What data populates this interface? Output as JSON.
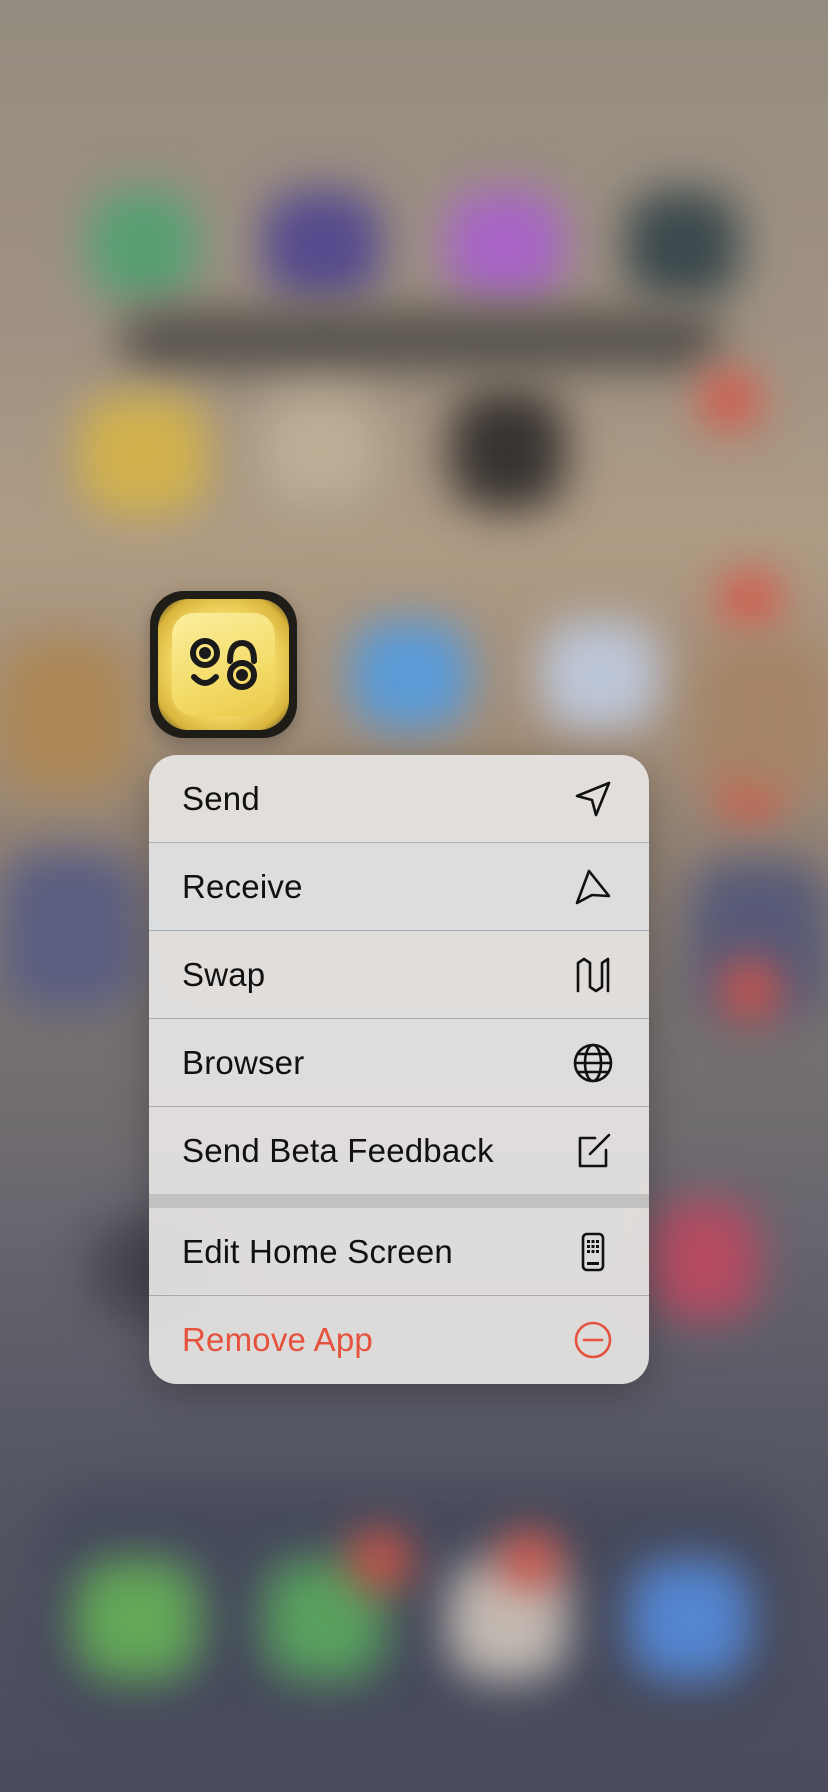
{
  "app": {
    "icon_name": "wallet-app-icon",
    "icon_colors": {
      "face": "#f4dc6a",
      "frame": "#1f1d18",
      "glyph": "#1a1a1a"
    }
  },
  "menu": {
    "actions": [
      {
        "label": "Send",
        "icon": "send-arrow-icon"
      },
      {
        "label": "Receive",
        "icon": "receive-arrow-icon"
      },
      {
        "label": "Swap",
        "icon": "swap-icon"
      },
      {
        "label": "Browser",
        "icon": "globe-icon"
      },
      {
        "label": "Send Beta Feedback",
        "icon": "compose-icon"
      }
    ],
    "system": [
      {
        "label": "Edit Home Screen",
        "icon": "phone-grid-icon"
      },
      {
        "label": "Remove App",
        "icon": "minus-circle-icon",
        "color": "#e5533f"
      }
    ]
  },
  "colors": {
    "menu_background": "#e8e6e4",
    "destructive": "#e5533f",
    "text": "#111111"
  }
}
